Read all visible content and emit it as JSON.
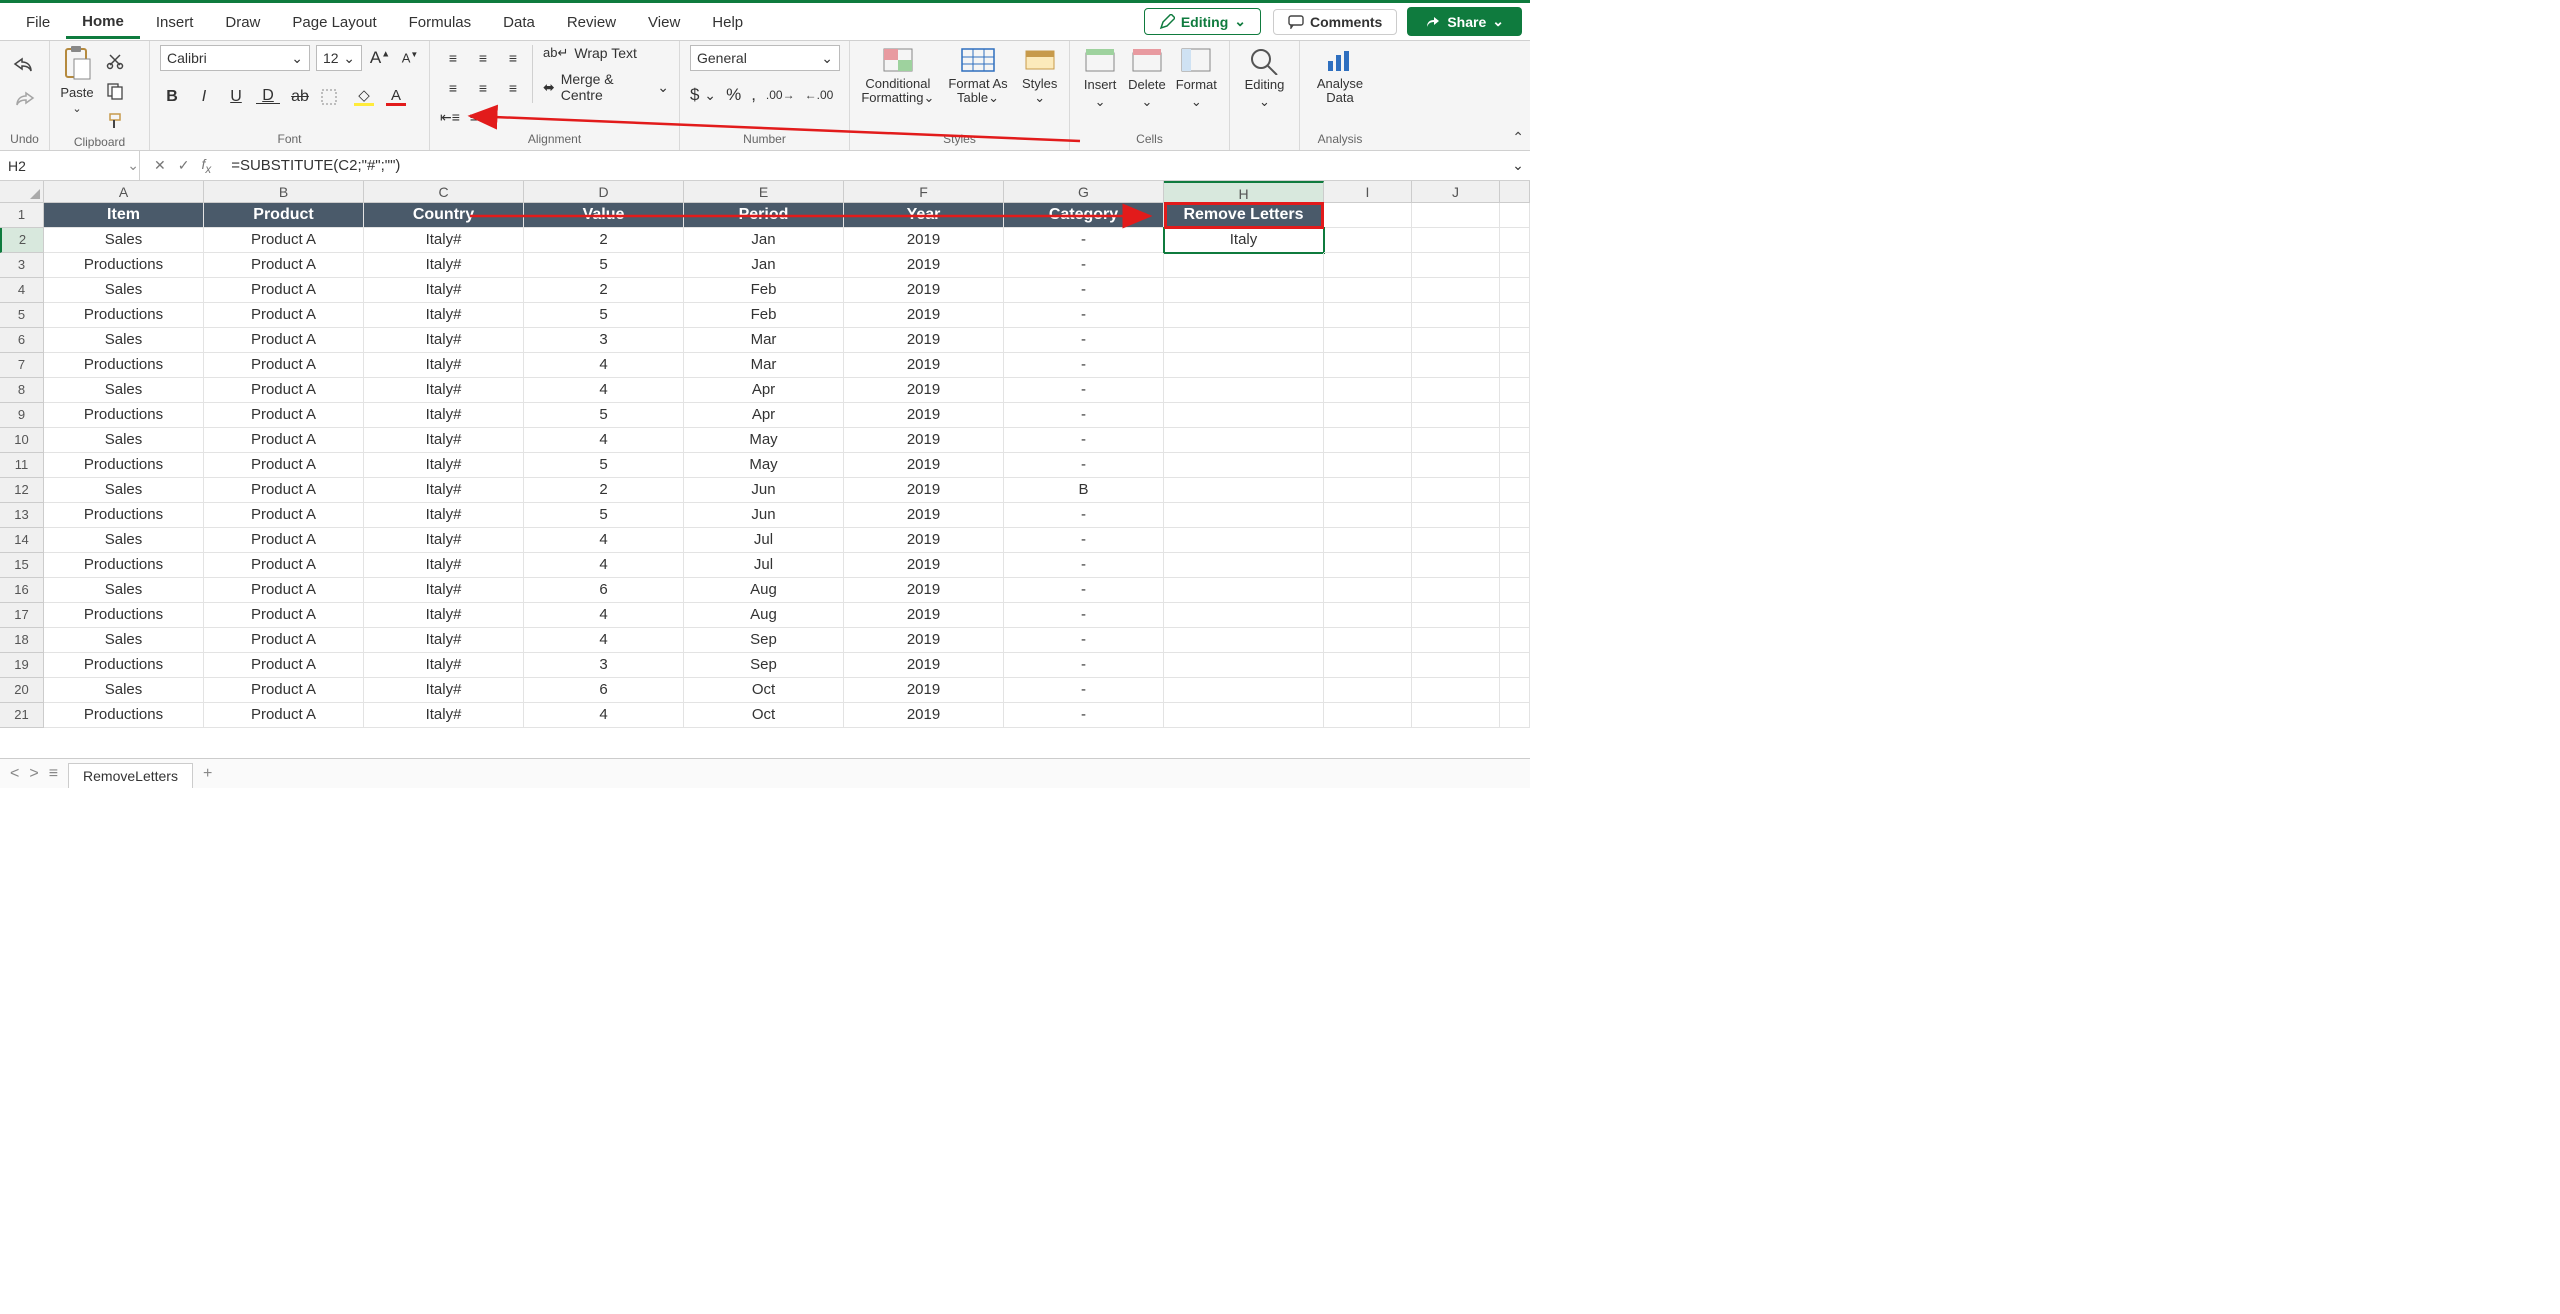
{
  "tabs": {
    "file": "File",
    "home": "Home",
    "insert": "Insert",
    "draw": "Draw",
    "page_layout": "Page Layout",
    "formulas": "Formulas",
    "data": "Data",
    "review": "Review",
    "view": "View",
    "help": "Help"
  },
  "topright": {
    "editing": "Editing",
    "comments": "Comments",
    "share": "Share"
  },
  "ribbon": {
    "undo_label": "Undo",
    "clipboard": {
      "paste": "Paste",
      "label": "Clipboard"
    },
    "font": {
      "name": "Calibri",
      "size": "12",
      "label": "Font"
    },
    "alignment": {
      "wrap": "Wrap Text",
      "merge": "Merge & Centre",
      "label": "Alignment"
    },
    "number": {
      "format": "General",
      "label": "Number"
    },
    "styles": {
      "cond": "Conditional Formatting",
      "fmt_as": "Format As Table",
      "styles": "Styles",
      "label": "Styles"
    },
    "cells": {
      "insert": "Insert",
      "delete": "Delete",
      "format": "Format",
      "label": "Cells"
    },
    "editing_grp": "Editing",
    "analysis": {
      "analyse": "Analyse Data",
      "label": "Analysis"
    }
  },
  "namebox": "H2",
  "formula": "=SUBSTITUTE(C2;\"#\";\"\")",
  "columns": [
    "A",
    "B",
    "C",
    "D",
    "E",
    "F",
    "G",
    "H",
    "I",
    "J",
    ""
  ],
  "header_row": [
    "Item",
    "Product",
    "Country",
    "Value",
    "Period",
    "Year",
    "Category",
    "Remove Letters",
    "",
    "",
    ""
  ],
  "rows": [
    [
      "Sales",
      "Product A",
      "Italy#",
      "2",
      "Jan",
      "2019",
      "-",
      "Italy",
      "",
      "",
      ""
    ],
    [
      "Productions",
      "Product A",
      "Italy#",
      "5",
      "Jan",
      "2019",
      "-",
      "",
      "",
      "",
      ""
    ],
    [
      "Sales",
      "Product A",
      "Italy#",
      "2",
      "Feb",
      "2019",
      "-",
      "",
      "",
      "",
      ""
    ],
    [
      "Productions",
      "Product A",
      "Italy#",
      "5",
      "Feb",
      "2019",
      "-",
      "",
      "",
      "",
      ""
    ],
    [
      "Sales",
      "Product A",
      "Italy#",
      "3",
      "Mar",
      "2019",
      "-",
      "",
      "",
      "",
      ""
    ],
    [
      "Productions",
      "Product A",
      "Italy#",
      "4",
      "Mar",
      "2019",
      "-",
      "",
      "",
      "",
      ""
    ],
    [
      "Sales",
      "Product A",
      "Italy#",
      "4",
      "Apr",
      "2019",
      "-",
      "",
      "",
      "",
      ""
    ],
    [
      "Productions",
      "Product A",
      "Italy#",
      "5",
      "Apr",
      "2019",
      "-",
      "",
      "",
      "",
      ""
    ],
    [
      "Sales",
      "Product A",
      "Italy#",
      "4",
      "May",
      "2019",
      "-",
      "",
      "",
      "",
      ""
    ],
    [
      "Productions",
      "Product A",
      "Italy#",
      "5",
      "May",
      "2019",
      "-",
      "",
      "",
      "",
      ""
    ],
    [
      "Sales",
      "Product A",
      "Italy#",
      "2",
      "Jun",
      "2019",
      "B",
      "",
      "",
      "",
      ""
    ],
    [
      "Productions",
      "Product A",
      "Italy#",
      "5",
      "Jun",
      "2019",
      "-",
      "",
      "",
      "",
      ""
    ],
    [
      "Sales",
      "Product A",
      "Italy#",
      "4",
      "Jul",
      "2019",
      "-",
      "",
      "",
      "",
      ""
    ],
    [
      "Productions",
      "Product A",
      "Italy#",
      "4",
      "Jul",
      "2019",
      "-",
      "",
      "",
      "",
      ""
    ],
    [
      "Sales",
      "Product A",
      "Italy#",
      "6",
      "Aug",
      "2019",
      "-",
      "",
      "",
      "",
      ""
    ],
    [
      "Productions",
      "Product A",
      "Italy#",
      "4",
      "Aug",
      "2019",
      "-",
      "",
      "",
      "",
      ""
    ],
    [
      "Sales",
      "Product A",
      "Italy#",
      "4",
      "Sep",
      "2019",
      "-",
      "",
      "",
      "",
      ""
    ],
    [
      "Productions",
      "Product A",
      "Italy#",
      "3",
      "Sep",
      "2019",
      "-",
      "",
      "",
      "",
      ""
    ],
    [
      "Sales",
      "Product A",
      "Italy#",
      "6",
      "Oct",
      "2019",
      "-",
      "",
      "",
      "",
      ""
    ],
    [
      "Productions",
      "Product A",
      "Italy#",
      "4",
      "Oct",
      "2019",
      "-",
      "",
      "",
      "",
      ""
    ]
  ],
  "sheet_tab": "RemoveLetters",
  "selected_col_index": 7,
  "selected_row_index": 1
}
